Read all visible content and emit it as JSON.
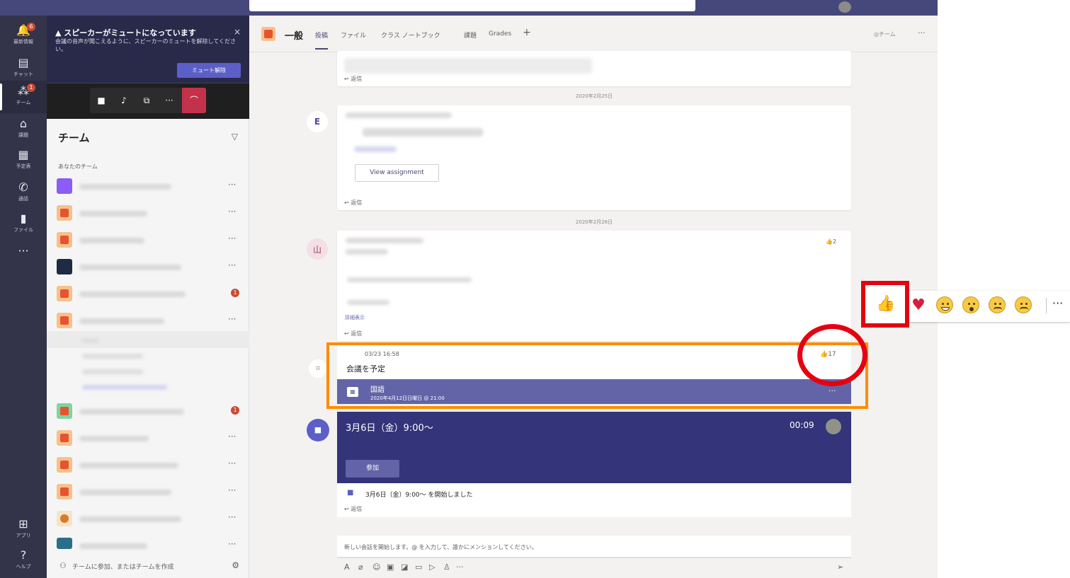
{
  "rail": {
    "items": [
      {
        "icon": "bell-icon",
        "glyph": "🔔",
        "label": "最新情報",
        "badge": "6"
      },
      {
        "icon": "chat-icon",
        "glyph": "▤",
        "label": "チャット",
        "badge": ""
      },
      {
        "icon": "teams-icon",
        "glyph": "⁂",
        "label": "チーム",
        "badge": "1"
      },
      {
        "icon": "assignments-icon",
        "glyph": "⌂",
        "label": "課題",
        "badge": ""
      },
      {
        "icon": "calendar-icon",
        "glyph": "▦",
        "label": "予定表",
        "badge": ""
      },
      {
        "icon": "calls-icon",
        "glyph": "✆",
        "label": "通話",
        "badge": ""
      },
      {
        "icon": "files-icon",
        "glyph": "▮",
        "label": "ファイル",
        "badge": ""
      },
      {
        "icon": "more-apps-icon",
        "glyph": "···",
        "label": "",
        "badge": ""
      }
    ],
    "bottom": [
      {
        "icon": "apps-icon",
        "glyph": "⊞",
        "label": "アプリ"
      },
      {
        "icon": "help-icon",
        "glyph": "?",
        "label": "ヘルプ"
      }
    ]
  },
  "notice": {
    "title": "▲ スピーカーがミュートになっています",
    "body": "会議の音声が聞こえるように、スピーカーのミュートを解除してください。",
    "close": "×",
    "unmute": "ミュート解除"
  },
  "call_controls": [
    "■",
    "♪",
    "⧉",
    "···",
    "⌒"
  ],
  "teams_panel": {
    "title": "チーム",
    "filter": "▽",
    "your_teams": "あなたのチーム",
    "join_create": "チームに参加、またはチームを作成",
    "more": "···",
    "unread_badge": "1"
  },
  "channel": {
    "name": "一般",
    "tabs": [
      "投稿",
      "ファイル",
      "クラス ノートブック",
      "課題",
      "Grades"
    ],
    "add_tab": "+",
    "team_button": "◎チーム",
    "more": "···"
  },
  "feed": {
    "date1": "2020年2月25日",
    "date2": "2020年2月26日",
    "view_assignment": "View assignment",
    "reply": "↩ 返信",
    "read_more": "詳細表示",
    "likes_small": "👍2",
    "avatar_letter": "山",
    "avatar_e": "E"
  },
  "meeting_message": {
    "time": "03/23 16:58",
    "text": "会議を予定",
    "like_count": "👍17",
    "subject": "国語",
    "when": "2020年4月12日日曜日 @ 21:00",
    "more": "···"
  },
  "live_meeting": {
    "title": "3月6日（金）9:00～",
    "duration": "00:09",
    "join": "参加",
    "started": "3月6日（金）9:00～ を開始しました"
  },
  "compose": {
    "placeholder": "新しい会話を開始します。@ を入力して、誰かにメンションしてください。",
    "send": "➢"
  },
  "reactions": {
    "like": "👍",
    "heart": "♥",
    "more": "···"
  }
}
